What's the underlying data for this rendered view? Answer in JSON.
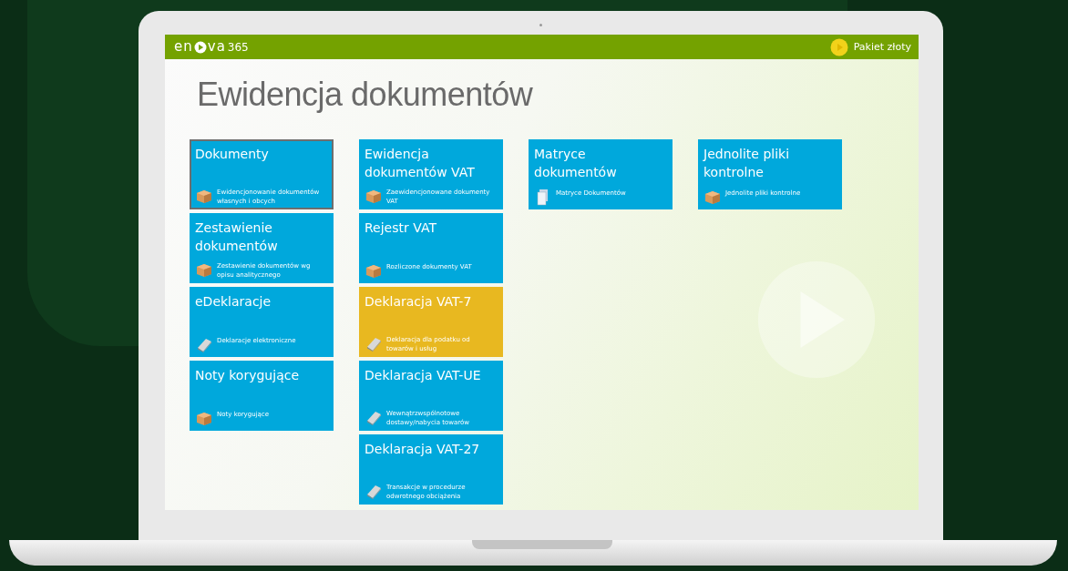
{
  "header": {
    "logo": {
      "start": "en",
      "end": "va",
      "suffix": "365"
    },
    "package": "Pakiet złoty"
  },
  "title": "Ewidencja dokumentów",
  "columns": [
    [
      {
        "title": "Dokumenty",
        "desc": "Ewidencjonowanie dokumentów własnych i obcych",
        "kind": "box",
        "color": "#00a8dc",
        "selected": true
      },
      {
        "title": "Zestawienie dokumentów",
        "desc": "Zestawienie dokumentów wg opisu analitycznego",
        "kind": "box",
        "color": "#00a8dc",
        "selected": false
      },
      {
        "title": "eDeklaracje",
        "desc": "Deklaracje elektroniczne",
        "kind": "book",
        "color": "#00a8dc",
        "selected": false
      },
      {
        "title": "Noty korygujące",
        "desc": "Noty korygujące",
        "kind": "box",
        "color": "#00a8dc",
        "selected": false
      }
    ],
    [
      {
        "title": "Ewidencja dokumentów VAT",
        "desc": "Zaewidencjonowane dokumenty VAT",
        "kind": "box",
        "color": "#00a8dc",
        "selected": false
      },
      {
        "title": "Rejestr VAT",
        "desc": "Rozliczone dokumenty VAT",
        "kind": "box",
        "color": "#00a8dc",
        "selected": false
      },
      {
        "title": "Deklaracja VAT-7",
        "desc": "Deklaracja dla podatku od towarów i usług",
        "kind": "book",
        "color": "#e8b820",
        "selected": false
      },
      {
        "title": "Deklaracja VAT-UE",
        "desc": "Wewnątrzwspólnotowe dostawy/nabycia towarów",
        "kind": "book",
        "color": "#00a8dc",
        "selected": false
      },
      {
        "title": "Deklaracja VAT-27",
        "desc": "Transakcje w procedurze odwrotnego obciążenia",
        "kind": "book",
        "color": "#00a8dc",
        "selected": false
      }
    ],
    [
      {
        "title": "Matryce dokumentów",
        "desc": "Matryce Dokumentów",
        "kind": "pages",
        "color": "#00a8dc",
        "selected": false
      }
    ],
    [
      {
        "title": "Jednolite pliki kontrolne",
        "desc": "Jednolite pliki kontrolne",
        "kind": "box",
        "color": "#00a8dc",
        "selected": false
      }
    ]
  ]
}
